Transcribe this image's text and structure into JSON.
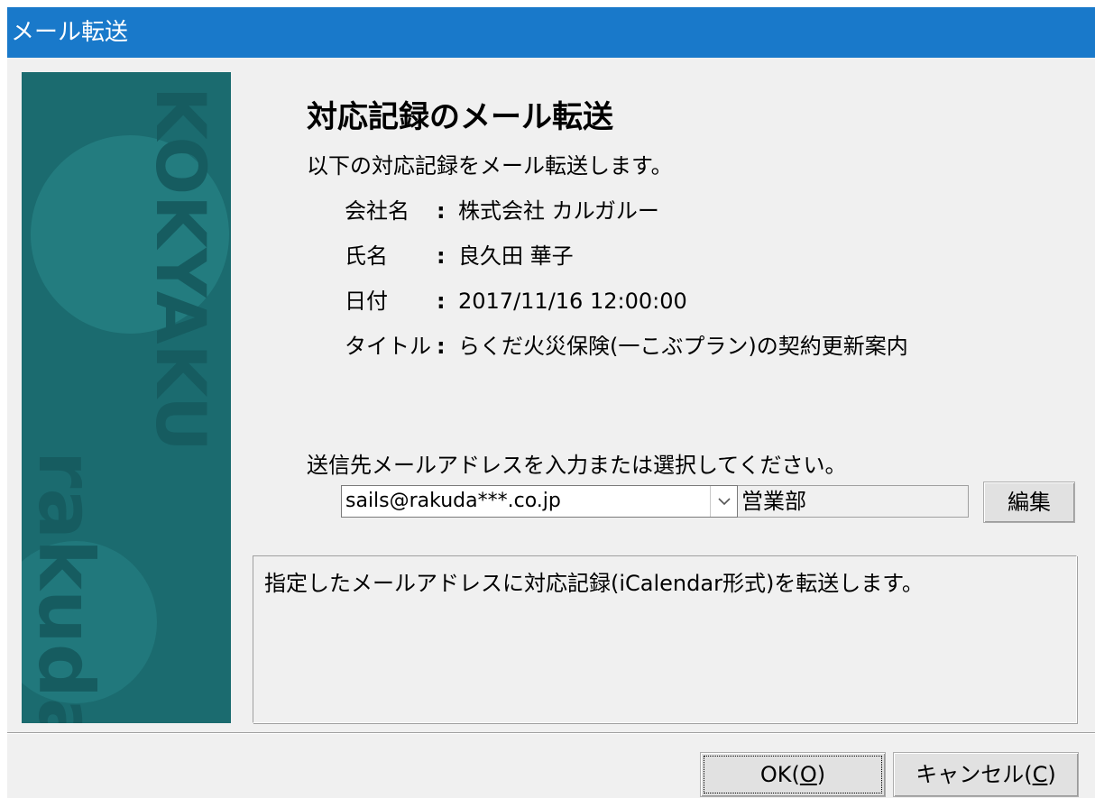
{
  "window": {
    "title": "メール転送"
  },
  "heading": "対応記録のメール転送",
  "intro": "以下の対応記録をメール転送します。",
  "record": {
    "company_label": "会社名",
    "company_value": "株式会社 カルガルー",
    "name_label": "氏名",
    "name_value": "良久田 華子",
    "date_label": "日付",
    "date_value": "2017/11/16 12:00:00",
    "title_label": "タイトル",
    "title_value": "らくだ火災保険(一こぶプラン)の契約更新案内",
    "colon": ":"
  },
  "address": {
    "prompt": "送信先メールアドレスを入力または選択してください。",
    "selected": "sails@rakuda***.co.jp",
    "department": "営業部",
    "edit_label": "編集"
  },
  "info": "指定したメールアドレスに対応記録(iCalendar形式)を転送します。",
  "buttons": {
    "ok_prefix": "OK(",
    "ok_key": "O",
    "ok_suffix": ")",
    "cancel_prefix": "キャンセル(",
    "cancel_key": "C",
    "cancel_suffix": ")"
  },
  "branding": {
    "vertical_top": "KOKYAKU",
    "vertical_bottom": "rakuda"
  },
  "colors": {
    "titlebar": "#1979ca",
    "sidepanel": "#1b6b6f"
  }
}
